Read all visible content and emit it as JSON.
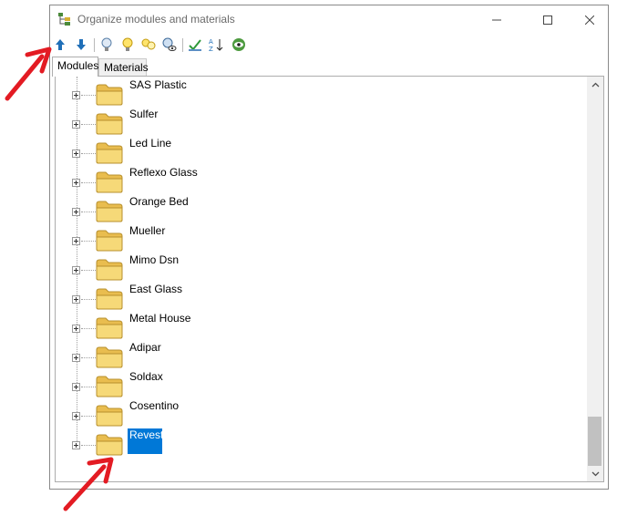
{
  "window": {
    "title": "Organize modules and materials",
    "icons": {
      "app": "tree-organize-icon",
      "minimize": "minimize-icon",
      "maximize": "maximize-icon",
      "close": "close-icon"
    }
  },
  "toolbar": {
    "buttons": [
      {
        "icon": "move-up-arrow-icon"
      },
      {
        "icon": "move-down-arrow-icon"
      },
      {
        "icon": "lightbulb-off-icon"
      },
      {
        "icon": "lightbulb-on-icon"
      },
      {
        "icon": "lightbulbs-icon"
      },
      {
        "icon": "lightbulb-eye-icon"
      },
      {
        "icon": "check-edit-icon"
      },
      {
        "icon": "sort-az-icon"
      },
      {
        "icon": "eye-toggle-icon"
      }
    ]
  },
  "tabs": [
    {
      "label": "Modules",
      "active": true
    },
    {
      "label": "Materials",
      "active": false
    }
  ],
  "tree": {
    "items": [
      {
        "label": "SAS Plastic"
      },
      {
        "label": "Sulfer"
      },
      {
        "label": "Led Line"
      },
      {
        "label": "Reflexo Glass"
      },
      {
        "label": "Orange Bed"
      },
      {
        "label": "Mueller"
      },
      {
        "label": "Mimo Dsn"
      },
      {
        "label": "East Glass"
      },
      {
        "label": "Metal House"
      },
      {
        "label": "Adipar"
      },
      {
        "label": "Soldax"
      },
      {
        "label": "Cosentino"
      },
      {
        "label": "Revest",
        "selected": true
      }
    ]
  },
  "colors": {
    "selection": "#0078d7",
    "annotation_arrow": "#e31b23",
    "folder": "#f2cf6b"
  }
}
